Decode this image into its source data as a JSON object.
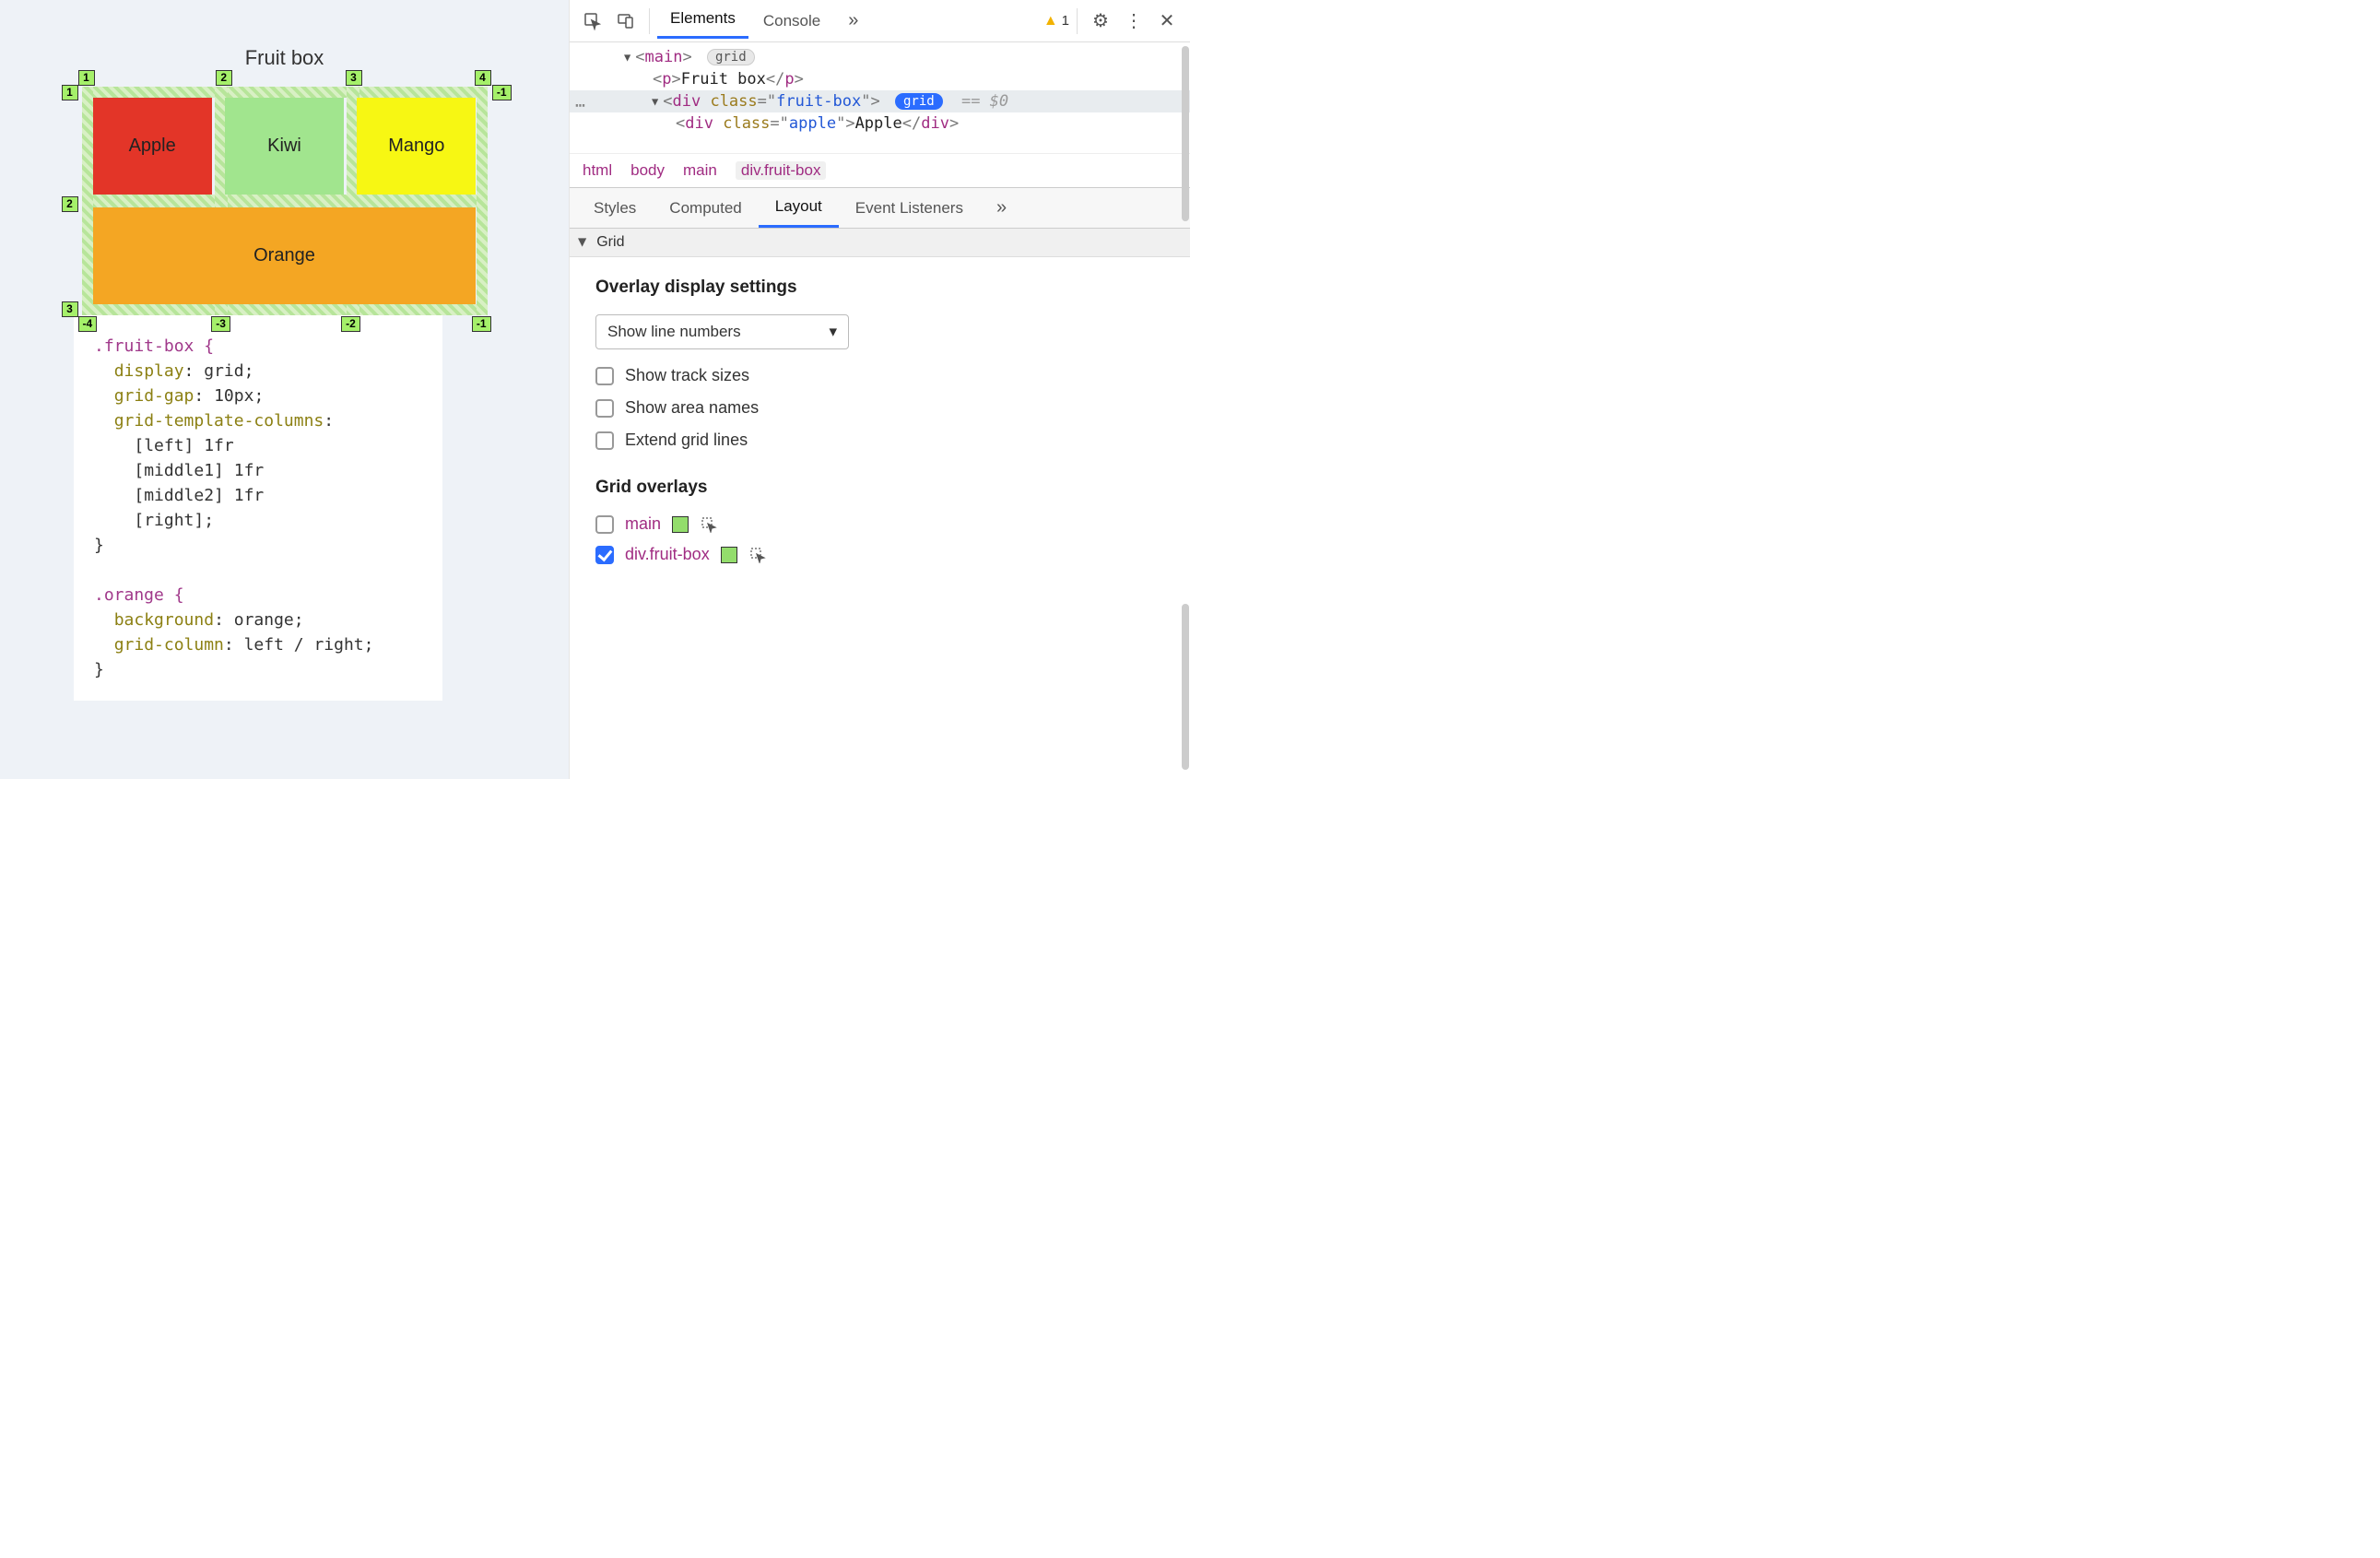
{
  "preview": {
    "title": "Fruit box",
    "cells": {
      "apple": "Apple",
      "kiwi": "Kiwi",
      "mango": "Mango",
      "orange": "Orange"
    },
    "line_numbers_top": [
      "1",
      "2",
      "3",
      "4"
    ],
    "line_numbers_left": [
      "1",
      "2",
      "3"
    ],
    "line_numbers_right": [
      "-1"
    ],
    "line_numbers_bottom": [
      "-4",
      "-3",
      "-2",
      "-1"
    ]
  },
  "css": {
    "fruit_box": {
      "selector": ".fruit-box {",
      "l1": "display",
      "v1": "grid",
      "l2": "grid-gap",
      "v2": "10px",
      "l3": "grid-template-columns",
      "ln1": "[left] 1fr",
      "ln2": "[middle1] 1fr",
      "ln3": "[middle2] 1fr",
      "ln4": "[right]",
      "close": "}"
    },
    "orange": {
      "selector": ".orange {",
      "l1": "background",
      "v1": "orange",
      "l2": "grid-column",
      "v2": "left / right",
      "close": "}"
    }
  },
  "toolbar": {
    "tabs": {
      "elements": "Elements",
      "console": "Console"
    },
    "more": "»",
    "warning_count": "1"
  },
  "dom": {
    "main_open": "main",
    "grid_pill": "grid",
    "p_open": "p",
    "p_text": "Fruit box",
    "p_close": "p",
    "div_tag": "div",
    "div_attr": "class",
    "div_val": "fruit-box",
    "eq": "== $0",
    "apple_tag": "div",
    "apple_attr": "class",
    "apple_val": "apple",
    "apple_text": "Apple"
  },
  "breadcrumb": [
    "html",
    "body",
    "main",
    "div.fruit-box"
  ],
  "subtabs": {
    "styles": "Styles",
    "computed": "Computed",
    "layout": "Layout",
    "listeners": "Event Listeners",
    "more": "»"
  },
  "grid_section": {
    "header": "Grid",
    "overlay_title": "Overlay display settings",
    "select": "Show line numbers",
    "opt_tracks": "Show track sizes",
    "opt_areas": "Show area names",
    "opt_extend": "Extend grid lines",
    "overlays_title": "Grid overlays",
    "overlays": [
      {
        "label": "main",
        "checked": false
      },
      {
        "label": "div.fruit-box",
        "checked": true
      }
    ]
  }
}
